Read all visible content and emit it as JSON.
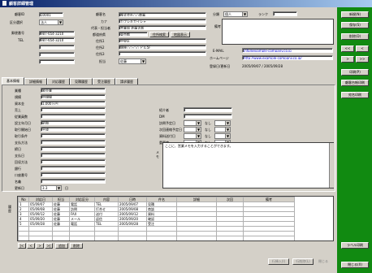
{
  "window": {
    "title": "顧客詳細管理"
  },
  "top": {
    "id_label": "顧客ID",
    "id_value": "10001",
    "kana_row_label": "区分選択",
    "kana_row_value": "法人",
    "postal_label": "郵便番号",
    "postal_value": "987-654-3210",
    "tel_label": "TEL",
    "tel_value": "987-654-3210",
    "company_label": "顧客名",
    "company_value": "株式会社○○商事",
    "kana_label": "カナ",
    "kana_value": "カブシキガイシャ",
    "rep_label": "代表・担当者",
    "rep_value": "営業部 佐藤太郎",
    "addr_label": "都道府県",
    "addr_value": "東京都",
    "addr_btn": "住所検索",
    "addr_btn2": "地図表示",
    "addr1_label": "住所1",
    "addr1_value": "中央区",
    "addr2_label": "住所2",
    "addr2_value": "銀座○○-○○ ビル5F",
    "addr3_label": "住所3",
    "addr3_value": "",
    "staff_label": "担当",
    "staff_value": "佐藤",
    "class_label": "分類",
    "class_value": "個人",
    "rank_label": "ランク",
    "rank_value": "",
    "memo_label": "備考",
    "email_label": "E-MAIL",
    "email_value": "info@example-company.co.jp",
    "url_label": "ホームページ",
    "url_value": "http://www.example-company.co.jp/",
    "reg_label": "登録日/更新日",
    "reg_value": "2005/09/07 / 2005/09/28"
  },
  "side_buttons": [
    "新規(N)",
    "保存(S)",
    "削除(D)",
    "<<",
    "<",
    ">",
    ">>",
    "印刷(P)",
    "顧客台帳印刷",
    "宛名印刷",
    "ラベル印刷",
    "閉じる(X)"
  ],
  "tabs": [
    "基本情報",
    "詳細情報",
    "対応履歴",
    "見積履歴",
    "受注履歴",
    "請求履歴"
  ],
  "detail": {
    "fields": [
      {
        "label": "業種",
        "value": "卸売業"
      },
      {
        "label": "規模",
        "value": "中規模"
      },
      {
        "label": "資本金",
        "value": "1,000万円"
      },
      {
        "label": "売上",
        "value": ""
      },
      {
        "label": "従業員数",
        "value": ""
      },
      {
        "label": "設立年月日",
        "value": "昭和"
      },
      {
        "label": "取引開始日",
        "value": "平成"
      },
      {
        "label": "取引条件",
        "value": ""
      },
      {
        "label": "支払方法",
        "value": ""
      },
      {
        "label": "締日",
        "value": ""
      },
      {
        "label": "支払日",
        "value": ""
      },
      {
        "label": "回収方法",
        "value": ""
      },
      {
        "label": "銀行",
        "value": ""
      },
      {
        "label": "口座番号",
        "value": ""
      },
      {
        "label": "名義",
        "value": ""
      }
    ],
    "right_fields": [
      {
        "label": "紹介者",
        "value": ""
      },
      {
        "label": "DM",
        "value": ""
      },
      {
        "label": "訪問予定日",
        "value": "",
        "sub": "なし"
      },
      {
        "label": "次回連絡予定日",
        "value": "",
        "sub": "なし"
      },
      {
        "label": "資料送付日",
        "value": "",
        "sub": "なし"
      },
      {
        "label": "重要度",
        "value": "",
        "sub": "なし"
      }
    ],
    "memo_text": "ここに、営業メモを入力することができます。",
    "memo_side": "メモ",
    "bottom_label": "更新日",
    "bottom_value": "3.3",
    "bottom_unit": "日"
  },
  "grid": {
    "headers": [
      "No",
      "対応日",
      "担当",
      "対応区分",
      "内容",
      "日時",
      "件名",
      "詳細",
      "次回",
      "備考"
    ],
    "rows": [
      [
        "1",
        "05/09/07",
        "佐藤",
        "電話",
        "TEL",
        "2005/09/07",
        "見積",
        "",
        "",
        ""
      ],
      [
        "2",
        "05/09/08",
        "佐藤",
        "訪問",
        "打合せ",
        "2005/09/08",
        "商談",
        "",
        "",
        ""
      ],
      [
        "3",
        "05/09/12",
        "佐藤",
        "FAX",
        "送付",
        "2005/09/12",
        "資料",
        "",
        "",
        ""
      ],
      [
        "4",
        "05/09/20",
        "佐藤",
        "メール",
        "返信",
        "2005/09/20",
        "確認",
        "",
        "",
        ""
      ],
      [
        "5",
        "05/09/28",
        "佐藤",
        "電話",
        "TEL",
        "2005/09/28",
        "受注",
        "",
        "",
        ""
      ]
    ],
    "side_label": "履歴",
    "nav": [
      "|<",
      "<",
      ">",
      ">|"
    ],
    "add_btn": "追加",
    "del_btn": "削除"
  },
  "footer": {
    "btn1": "行挿入(I)",
    "btn2": "行削除(L)",
    "btn3": "閉じる"
  }
}
